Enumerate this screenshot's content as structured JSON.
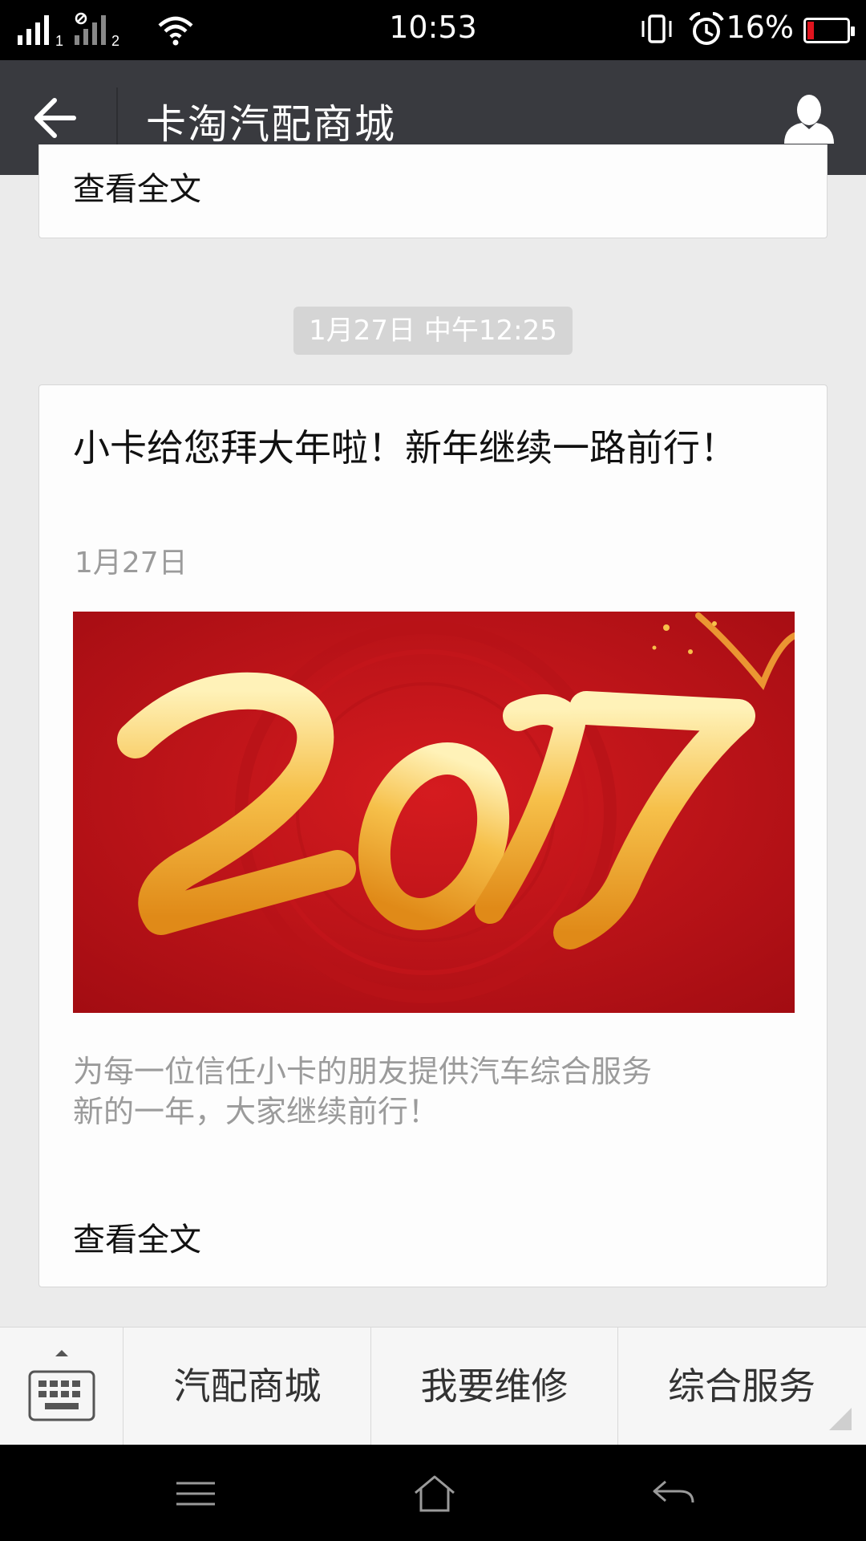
{
  "status_bar": {
    "time": "10:53",
    "battery_percent": "16%",
    "battery_level": 0.16,
    "sim1_label": "1",
    "sim2_label": "2"
  },
  "header": {
    "title": "卡淘汽配商城",
    "back_icon": "arrow-left-icon",
    "profile_icon": "person-icon"
  },
  "feed": {
    "previous_card": {
      "read_more": "查看全文"
    },
    "timestamp": "1月27日 中午12:25",
    "article": {
      "title": "小卡给您拜大年啦！新年继续一路前行！",
      "date": "1月27日",
      "cover_text": "2017",
      "summary": "为每一位信任小卡的朋友提供汽车综合服务\n新的一年，大家继续前行！",
      "read_more": "查看全文"
    }
  },
  "menu": {
    "keyboard_icon": "keyboard-icon",
    "items": [
      {
        "label": "汽配商城"
      },
      {
        "label": "我要维修"
      },
      {
        "label": "综合服务"
      }
    ]
  },
  "nav_bar": {
    "icons": [
      "menu-icon",
      "home-icon",
      "back-icon"
    ]
  },
  "colors": {
    "title_bar": "#393a3f",
    "cover_red": "#c0121a",
    "cover_gold": "#f2b43a"
  }
}
